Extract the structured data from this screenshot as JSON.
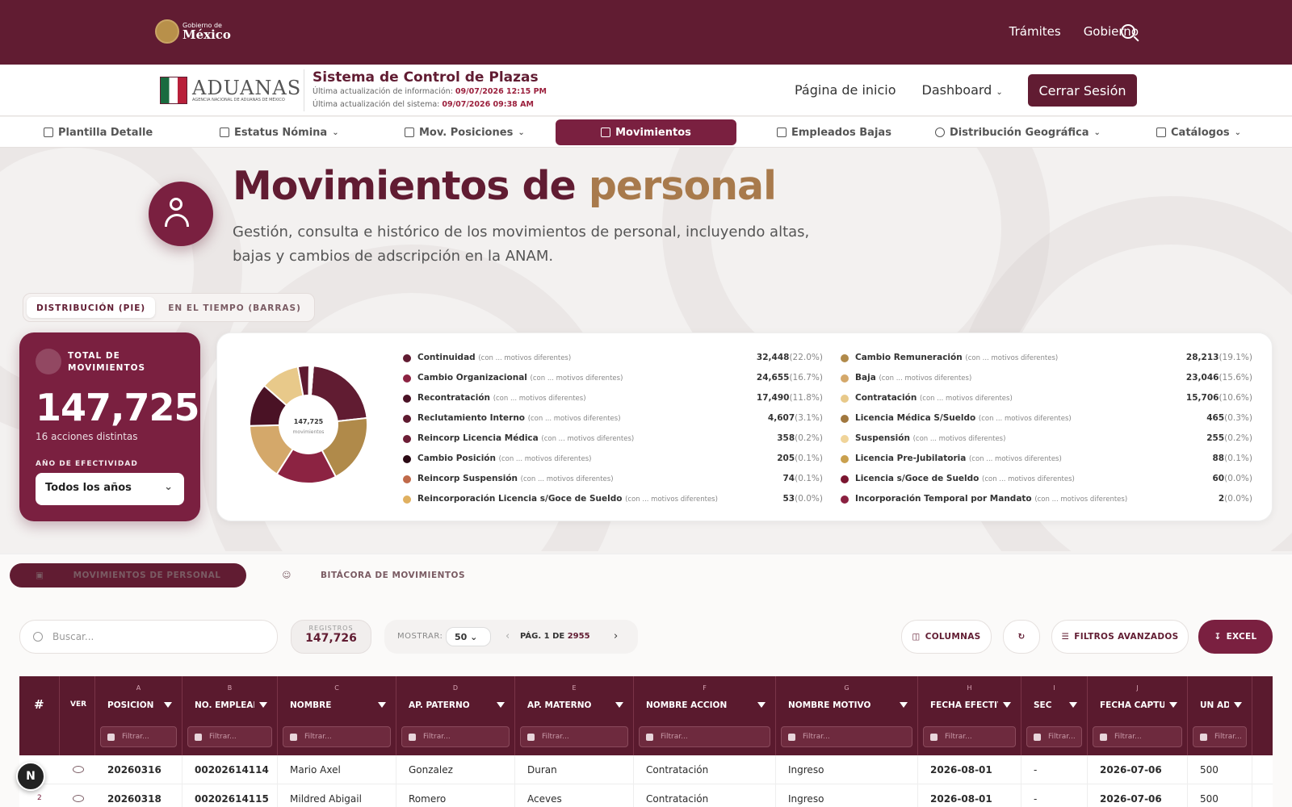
{
  "gob": {
    "line1": "Gobierno de",
    "line2": "México"
  },
  "topnav": {
    "tramites": "Trámites",
    "gobierno": "Gobierno"
  },
  "aduanas": {
    "name": "ADUANAS",
    "sub": "AGENCIA NACIONAL DE ADUANAS DE MÉXICO"
  },
  "system": {
    "title": "Sistema de Control de Plazas",
    "info_label": "Última actualización de información:",
    "info_date": "09/07/2026 12:15 PM",
    "sys_label": "Última actualización del sistema:",
    "sys_date": "09/07/2026 09:38 AM"
  },
  "header_nav": {
    "home": "Página de inicio",
    "dashboard": "Dashboard",
    "logout": "Cerrar Sesión"
  },
  "tabs": {
    "plantilla": "Plantilla Detalle",
    "estatus": "Estatus Nómina",
    "mov_pos": "Mov. Posiciones",
    "movimientos": "Movimientos",
    "bajas": "Empleados Bajas",
    "geo": "Distribución Geográfica",
    "catalogos": "Catálogos"
  },
  "hero": {
    "title_a": "Movimientos de",
    "title_b": "personal",
    "desc": "Gestión, consulta e histórico de los movimientos de personal, incluyendo altas, bajas y cambios de adscripción en la ANAM."
  },
  "view_toggle": {
    "pie": "DISTRIBUCIÓN (PIE)",
    "bars": "EN EL TIEMPO (BARRAS)"
  },
  "total_card": {
    "label": "TOTAL DE MOVIMIENTOS",
    "value": "147,725",
    "sub": "16 acciones distintas",
    "year_label": "AÑO DE EFECTIVIDAD",
    "year_value": "Todos los años"
  },
  "chart_data": {
    "type": "pie",
    "center_value": "147,725",
    "center_label": "movimientos",
    "motivos_note": "(con ... motivos diferentes)",
    "slices": [
      {
        "name": "Continuidad",
        "value": 32448,
        "pct": "22.0%",
        "color": "#611c32"
      },
      {
        "name": "Cambio Remuneración",
        "value": 28213,
        "pct": "19.1%",
        "color": "#b08a4a"
      },
      {
        "name": "Cambio Organizacional",
        "value": 24655,
        "pct": "16.7%",
        "color": "#8c2342"
      },
      {
        "name": "Baja",
        "value": 23046,
        "pct": "15.6%",
        "color": "#d4a86a"
      },
      {
        "name": "Recontratación",
        "value": 17490,
        "pct": "11.8%",
        "color": "#4a1225"
      },
      {
        "name": "Contratación",
        "value": 15706,
        "pct": "10.6%",
        "color": "#e8c98a"
      },
      {
        "name": "Reclutamiento Interno",
        "value": 4607,
        "pct": "3.1%",
        "color": "#5e1a30"
      },
      {
        "name": "Licencia Médica S/Sueldo",
        "value": 465,
        "pct": "0.3%",
        "color": "#a0773e"
      },
      {
        "name": "Reincorp Licencia Médica",
        "value": 358,
        "pct": "0.2%",
        "color": "#6d1e36"
      },
      {
        "name": "Suspensión",
        "value": 255,
        "pct": "0.2%",
        "color": "#f0d49a"
      },
      {
        "name": "Cambio Posición",
        "value": 205,
        "pct": "0.1%",
        "color": "#2a0a14"
      },
      {
        "name": "Licencia Pre-Jubilatoria",
        "value": 88,
        "pct": "0.1%",
        "color": "#c9a04e"
      },
      {
        "name": "Reincorp Suspensión",
        "value": 74,
        "pct": "0.1%",
        "color": "#c06a4a"
      },
      {
        "name": "Licencia s/Goce de Sueldo",
        "value": 60,
        "pct": "0.0%",
        "color": "#7a1530"
      },
      {
        "name": "Reincorporación Licencia s/Goce de Sueldo",
        "value": 53,
        "pct": "0.0%",
        "color": "#e0b060"
      },
      {
        "name": "Incorporación Temporal por Mandato",
        "value": 2,
        "pct": "0.0%",
        "color": "#8a2040"
      }
    ]
  },
  "legend_left": [
    {
      "name": "Continuidad",
      "value": "32,448",
      "pct": "(22.0%)",
      "color": "#611c32"
    },
    {
      "name": "Cambio Organizacional",
      "value": "24,655",
      "pct": "(16.7%)",
      "color": "#8c2342"
    },
    {
      "name": "Recontratación",
      "value": "17,490",
      "pct": "(11.8%)",
      "color": "#4a1225"
    },
    {
      "name": "Reclutamiento Interno",
      "value": "4,607",
      "pct": "(3.1%)",
      "color": "#5e1a30"
    },
    {
      "name": "Reincorp Licencia Médica",
      "value": "358",
      "pct": "(0.2%)",
      "color": "#6d1e36"
    },
    {
      "name": "Cambio Posición",
      "value": "205",
      "pct": "(0.1%)",
      "color": "#2a0a14"
    },
    {
      "name": "Reincorp Suspensión",
      "value": "74",
      "pct": "(0.1%)",
      "color": "#c06a4a"
    },
    {
      "name": "Reincorporación Licencia s/Goce de Sueldo",
      "value": "53",
      "pct": "(0.0%)",
      "color": "#e0b060"
    }
  ],
  "legend_right": [
    {
      "name": "Cambio Remuneración",
      "value": "28,213",
      "pct": "(19.1%)",
      "color": "#b08a4a"
    },
    {
      "name": "Baja",
      "value": "23,046",
      "pct": "(15.6%)",
      "color": "#d4a86a"
    },
    {
      "name": "Contratación",
      "value": "15,706",
      "pct": "(10.6%)",
      "color": "#e8c98a"
    },
    {
      "name": "Licencia Médica S/Sueldo",
      "value": "465",
      "pct": "(0.3%)",
      "color": "#a0773e"
    },
    {
      "name": "Suspensión",
      "value": "255",
      "pct": "(0.2%)",
      "color": "#f0d49a"
    },
    {
      "name": "Licencia Pre-Jubilatoria",
      "value": "88",
      "pct": "(0.1%)",
      "color": "#c9a04e"
    },
    {
      "name": "Licencia s/Goce de Sueldo",
      "value": "60",
      "pct": "(0.0%)",
      "color": "#7a1530"
    },
    {
      "name": "Incorporación Temporal por Mandato",
      "value": "2",
      "pct": "(0.0%)",
      "color": "#8a2040"
    }
  ],
  "subtabs": {
    "personal": "MOVIMIENTOS DE PERSONAL",
    "bitacora": "BITÁCORA DE MOVIMIENTOS"
  },
  "toolbar": {
    "search_placeholder": "Buscar...",
    "reg_label": "REGISTROS",
    "reg_value": "147,726",
    "show_label": "MOSTRAR:",
    "show_value": "50",
    "page_prefix": "PÁG. 1 DE",
    "page_total": "2955",
    "columns": "COLUMNAS",
    "filters": "FILTROS AVANZADOS",
    "excel": "EXCEL"
  },
  "grid": {
    "hash": "#",
    "ver": "VER",
    "filter_placeholder": "Filtrar...",
    "columns": [
      {
        "letter": "A",
        "name": "POSICIÓN"
      },
      {
        "letter": "B",
        "name": "NO. EMPLEADO"
      },
      {
        "letter": "C",
        "name": "NOMBRE"
      },
      {
        "letter": "D",
        "name": "AP. PATERNO"
      },
      {
        "letter": "E",
        "name": "AP. MATERNO"
      },
      {
        "letter": "F",
        "name": "NOMBRE ACCIÓN"
      },
      {
        "letter": "G",
        "name": "NOMBRE MOTIVO"
      },
      {
        "letter": "H",
        "name": "FECHA EFECTIVA"
      },
      {
        "letter": "I",
        "name": "SEC"
      },
      {
        "letter": "J",
        "name": "FECHA CAPTURA"
      },
      {
        "letter": "",
        "name": "UN ADMIN..."
      }
    ],
    "rows": [
      {
        "n": "",
        "posicion": "20260316",
        "empleado": "00202614114",
        "nombre": "Mario Axel",
        "paterno": "Gonzalez",
        "materno": "Duran",
        "accion": "Contratación",
        "motivo": "Ingreso",
        "fecha": "2026-08-01",
        "sec": "-",
        "captura": "2026-07-06",
        "unadmin": "500"
      },
      {
        "n": "2",
        "posicion": "20260318",
        "empleado": "00202614115",
        "nombre": "Mildred Abigail",
        "paterno": "Romero",
        "materno": "Aceves",
        "accion": "Contratación",
        "motivo": "Ingreso",
        "fecha": "2026-08-01",
        "sec": "-",
        "captura": "2026-07-06",
        "unadmin": "500"
      }
    ]
  },
  "badge": "N"
}
